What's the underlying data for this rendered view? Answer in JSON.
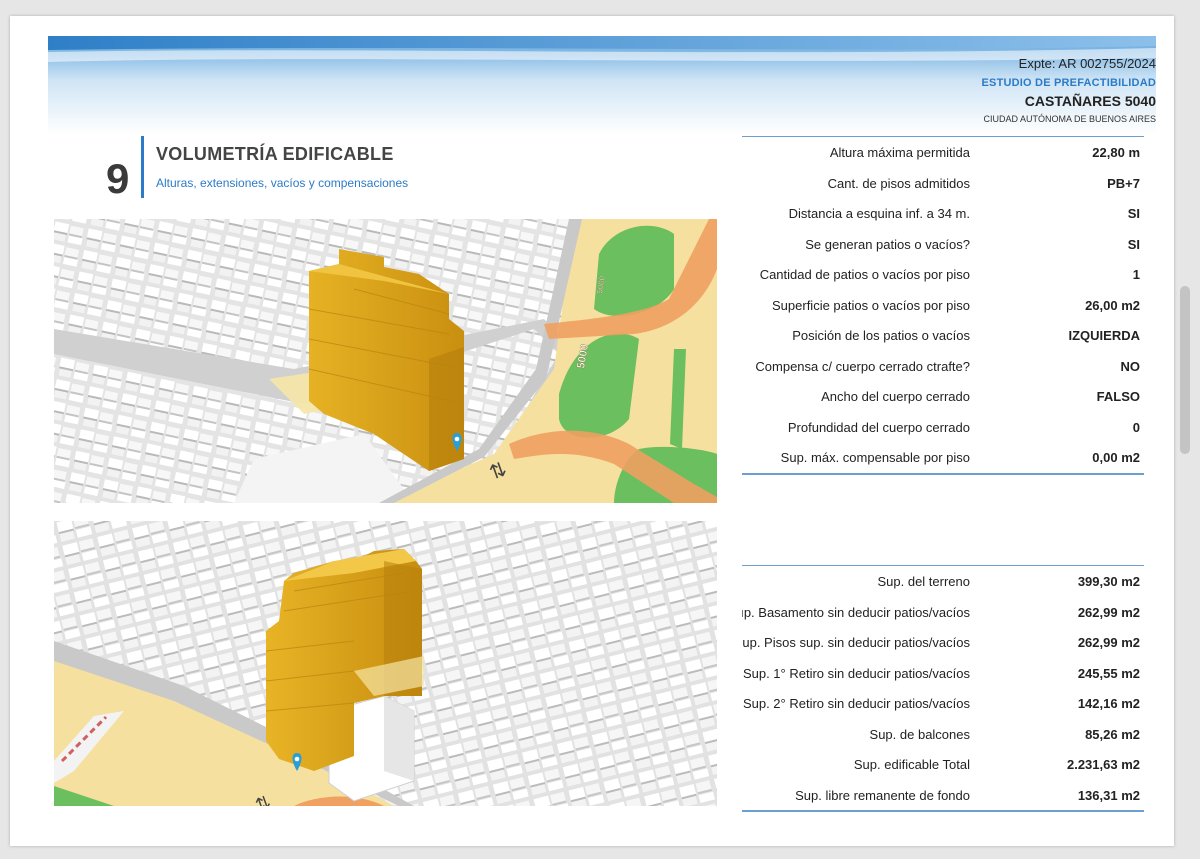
{
  "header": {
    "expte": "Expte: AR 002755/2024",
    "estudio": "ESTUDIO DE PREFACTIBILIDAD",
    "address": "CASTAÑARES 5040",
    "city": "CIUDAD AUTÓNOMA DE BUENOS AIRES"
  },
  "section": {
    "number": "9",
    "title": "VOLUMETRÍA EDIFICABLE",
    "subtitle": "Alturas, extensiones, vacíos y compensaciones"
  },
  "map": {
    "street_number": "5000",
    "street_number_small": "5000"
  },
  "table1": {
    "rows": [
      {
        "label": "Altura máxima permitida",
        "value": "22,80 m"
      },
      {
        "label": "Cant. de pisos admitidos",
        "value": "PB+7"
      },
      {
        "label": "Distancia a esquina inf. a 34 m.",
        "value": "SI"
      },
      {
        "label": "Se generan patios o vacíos?",
        "value": "SI"
      },
      {
        "label": "Cantidad de patios o vacíos por piso",
        "value": "1"
      },
      {
        "label": "Superficie patios o vacíos por piso",
        "value": "26,00 m2"
      },
      {
        "label": "Posición de los patios o vacíos",
        "value": "IZQUIERDA"
      },
      {
        "label": "Compensa c/ cuerpo cerrado ctrafte?",
        "value": "NO"
      },
      {
        "label": "Ancho del  cuerpo cerrado",
        "value": "FALSO"
      },
      {
        "label": "Profundidad del  cuerpo cerrado",
        "value": "0"
      },
      {
        "label": "Sup. máx. compensable por piso",
        "value": "0,00 m2"
      }
    ]
  },
  "table2": {
    "rows": [
      {
        "label": "Sup. del terreno",
        "value": "399,30 m2"
      },
      {
        "label": "ıp. Basamento sin deducir patios/vacíos",
        "value": "262,99 m2"
      },
      {
        "label": "up. Pisos sup. sin deducir patios/vacíos",
        "value": "262,99 m2"
      },
      {
        "label": "Sup. 1° Retiro sin deducir patios/vacíos",
        "value": "245,55 m2"
      },
      {
        "label": "Sup. 2° Retiro sin deducir patios/vacíos",
        "value": "142,16 m2"
      },
      {
        "label": "Sup. de balcones",
        "value": "85,26 m2"
      },
      {
        "label": "Sup. edificable Total",
        "value": "2.231,63 m2"
      },
      {
        "label": "Sup. libre remanente de fondo",
        "value": "136,31 m2"
      }
    ]
  },
  "colors": {
    "accent_blue": "#2b7bc8",
    "building_volume": "#e0a81c",
    "avenue": "#f6e0a0",
    "park": "#6cbf5e",
    "route": "#f0a060",
    "marker": "#2a9fd6"
  }
}
